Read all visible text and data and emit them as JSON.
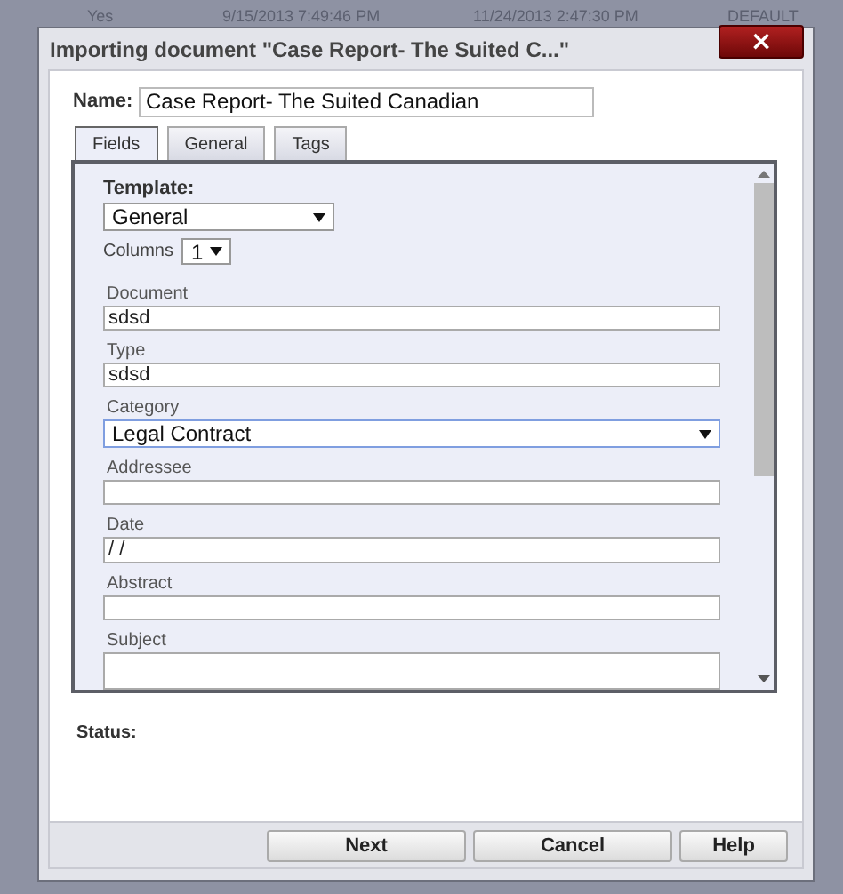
{
  "background_row": [
    "Yes",
    "9/15/2013 7:49:46 PM",
    "11/24/2013 2:47:30 PM",
    "DEFAULT"
  ],
  "dialog": {
    "title": "Importing document \"Case Report- The Suited C...\"",
    "close": "×",
    "name_label": "Name:",
    "name_value": "Case Report- The Suited Canadian",
    "tabs": [
      {
        "label": "Fields",
        "selected": true
      },
      {
        "label": "General",
        "selected": false
      },
      {
        "label": "Tags",
        "selected": false
      }
    ],
    "template": {
      "label": "Template:",
      "value": "General"
    },
    "columns": {
      "label": "Columns",
      "value": "1"
    },
    "fields": [
      {
        "label": "Document",
        "kind": "text",
        "value": "sdsd",
        "focused": false
      },
      {
        "label": "Type",
        "kind": "text",
        "value": "sdsd",
        "focused": false
      },
      {
        "label": "Category",
        "kind": "select",
        "value": "Legal Contract",
        "focused": true
      },
      {
        "label": "Addressee",
        "kind": "text",
        "focused": false
      },
      {
        "label": "Date",
        "kind": "text",
        "value": "/ /",
        "focused": false
      },
      {
        "label": "Abstract",
        "kind": "text",
        "focused": false
      },
      {
        "label": "Subject",
        "kind": "textarea",
        "focused": false
      }
    ],
    "status_label": "Status:",
    "buttons": [
      "Next",
      "Cancel",
      "Help"
    ]
  }
}
